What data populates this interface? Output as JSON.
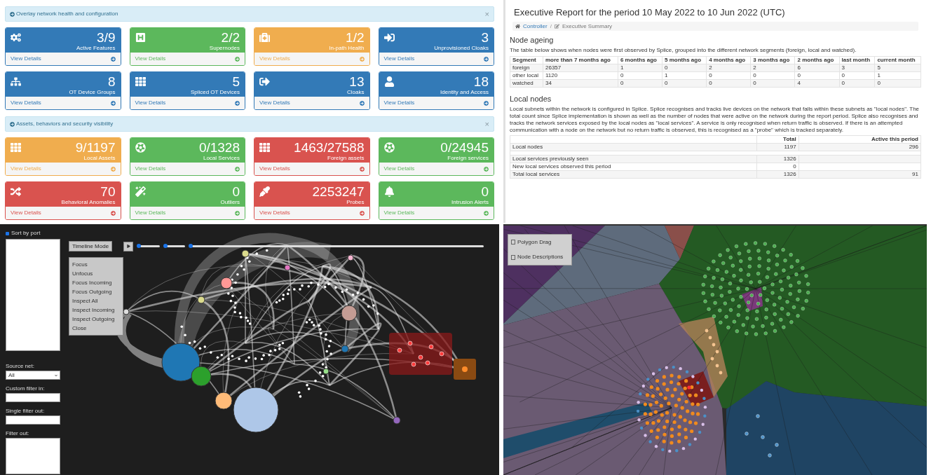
{
  "dashboard": {
    "sections": [
      {
        "title": "Overlay network health and configuration",
        "close": "×",
        "tiles": [
          {
            "value": "3/9",
            "label": "Active Features",
            "color": "#337ab7",
            "footer": "View Details"
          },
          {
            "value": "2/2",
            "label": "Supernodes",
            "color": "#5cb85c",
            "footer": "View Details"
          },
          {
            "value": "1/2",
            "label": "In-path Health",
            "color": "#f0ad4e",
            "footer": "View Details"
          },
          {
            "value": "3",
            "label": "Unprovisioned Cloaks",
            "color": "#337ab7",
            "footer": "View Details"
          },
          {
            "value": "8",
            "label": "OT Device Groups",
            "color": "#337ab7",
            "footer": "View Details"
          },
          {
            "value": "5",
            "label": "Spliced OT Devices",
            "color": "#337ab7",
            "footer": "View Details"
          },
          {
            "value": "13",
            "label": "Cloaks",
            "color": "#337ab7",
            "footer": "View Details"
          },
          {
            "value": "18",
            "label": "Identity and Access",
            "color": "#337ab7",
            "footer": "View Details"
          }
        ]
      },
      {
        "title": "Assets, behaviors and security visibility",
        "close": "×",
        "tiles": [
          {
            "value": "9/1197",
            "label": "Local Assets",
            "color": "#f0ad4e",
            "footer": "View Details"
          },
          {
            "value": "0/1328",
            "label": "Local Services",
            "color": "#5cb85c",
            "footer": "View Details"
          },
          {
            "value": "1463/27588",
            "label": "Foreign assets",
            "color": "#d9534f",
            "footer": "View Details"
          },
          {
            "value": "0/24945",
            "label": "Foreign services",
            "color": "#5cb85c",
            "footer": "View Details"
          },
          {
            "value": "70",
            "label": "Behavioral Anomalies",
            "color": "#d9534f",
            "footer": "View Details"
          },
          {
            "value": "0",
            "label": "Outliers",
            "color": "#5cb85c",
            "footer": "View Details"
          },
          {
            "value": "2253247",
            "label": "Probes",
            "color": "#d9534f",
            "footer": "View Details"
          },
          {
            "value": "0",
            "label": "Intrusion Alerts",
            "color": "#5cb85c",
            "footer": "View Details"
          }
        ]
      }
    ]
  },
  "report": {
    "title": "Executive Report for the period 10 May 2022 to 10 Jun 2022 (UTC)",
    "breadcrumb": [
      "Controller",
      "Executive Summary"
    ],
    "breadcrumb_separator": "/",
    "ageing": {
      "heading": "Node ageing",
      "text": "The table below shows when nodes were first observed by Splice, grouped into the different network segments (foreign, local and watched).",
      "columns": [
        "Segment",
        "more than 7 months ago",
        "6 months ago",
        "5 months ago",
        "4 months ago",
        "3 months ago",
        "2 months ago",
        "last month",
        "current month"
      ],
      "rows": [
        [
          "foreign",
          "26357",
          "1",
          "0",
          "2",
          "2",
          "6",
          "3",
          "5"
        ],
        [
          "other local",
          "1120",
          "0",
          "1",
          "0",
          "0",
          "0",
          "0",
          "1"
        ],
        [
          "watched",
          "34",
          "0",
          "0",
          "0",
          "0",
          "4",
          "0",
          "0"
        ]
      ]
    },
    "local": {
      "heading": "Local nodes",
      "text": "Local subnets within the network is configured in Splice. Splice recognises and tracks live devices on the network that falls within these subnets as \"local nodes\". The total count since Splice implementation is shown as well as the number of nodes that were active on the network during the report period. Splice also recognises and tracks the network services exposed by the local nodes as \"local services\". A service is only recognised when return traffic is observed. If there is an attempted communication with a node on the network but no return traffic is observed, this is recognised as a \"probe\" which is tracked separately.",
      "columns": [
        "Total",
        "Active this period"
      ],
      "rows": [
        {
          "kind": "data",
          "cells": [
            "Local nodes",
            "1197",
            "296"
          ]
        },
        {
          "kind": "spacer"
        },
        {
          "kind": "data",
          "cells": [
            "Local services previously seen",
            "1326"
          ]
        },
        {
          "kind": "data",
          "cells": [
            "New local services observed this period",
            "0"
          ]
        },
        {
          "kind": "data",
          "cells": [
            "Total local services",
            "1326",
            "91"
          ]
        }
      ]
    }
  },
  "graph_view": {
    "sort_by_port": {
      "label": "Sort by port",
      "checked": true
    },
    "timeline_button": "Timeline Mode",
    "sliders": [
      {
        "level": 0
      },
      {
        "level": 0
      },
      {
        "level": 0
      }
    ],
    "context_menu": [
      "Focus",
      "Unfocus",
      "Focus Incoming",
      "Focus Outgoing",
      "Inspect All",
      "Inspect Incoming",
      "Inspect Outgoing",
      "Close"
    ],
    "source_net": {
      "label": "Source net:",
      "value": "All"
    },
    "custom_filter_in": {
      "label": "Custom filter in:"
    },
    "single_filter_out": {
      "label": "Single filter out:"
    },
    "filter_out": {
      "label": "Filter out:"
    }
  },
  "voronoi_view": {
    "options": [
      {
        "label": "Polygon Drag",
        "checked": false
      },
      {
        "label": "Node Descriptions",
        "checked": false
      }
    ]
  }
}
